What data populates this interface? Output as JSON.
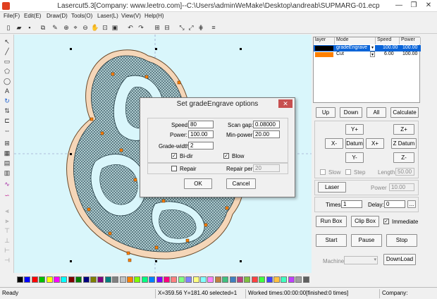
{
  "app": {
    "title": "Lasercut5.3[Company: www.leetro.com]--C:\\Users\\adminWeMake\\Desktop\\andreab\\SUPMARG-01.ecp",
    "min": "—",
    "max": "❐",
    "close": "✕"
  },
  "menu": [
    "File(F)",
    "Edit(E)",
    "Draw(D)",
    "Tools(O)",
    "Laser(L)",
    "View(V)",
    "Help(H)"
  ],
  "layers": {
    "headers": [
      "layer",
      "Mode",
      "Speed",
      "Power"
    ],
    "rows": [
      {
        "color": "#000000",
        "mode": "gradeEngrave",
        "speed": "100.00",
        "power": "100.00",
        "selected": true
      },
      {
        "color": "#ff8000",
        "mode": "Cut",
        "speed": "6.00",
        "power": "100.00",
        "selected": false
      }
    ]
  },
  "panel": {
    "up": "Up",
    "down": "Down",
    "all": "All",
    "calculate": "Calculate",
    "yplus": "Y+",
    "xminus": "X-",
    "datum": "Datum",
    "xplus": "X+",
    "yminus": "Y-",
    "zplus": "Z+",
    "zdatum": "Z Datum",
    "zminus": "Z-",
    "slow": "Slow",
    "step": "Step",
    "length_label": "Length",
    "length_value": "50.00",
    "laser": "Laser",
    "power_label": "Power",
    "power_value": "10.00",
    "times_label": "Times:",
    "times_value": "1",
    "delay_label": "Delay:",
    "delay_value": "0",
    "delay_btn": "...",
    "runbox": "Run Box",
    "clipbox": "Clip Box",
    "immediate": "Immediate",
    "start": "Start",
    "pause": "Pause",
    "stop": "Stop",
    "machine_label": "Machine:",
    "download": "DownLoad"
  },
  "dialog": {
    "title": "Set gradeEngrave options",
    "speed_label": "Speed:",
    "speed": "80",
    "scangap_label": "Scan gap:",
    "scangap": "0.08000",
    "power_label": "Power:",
    "power": "100.00",
    "minpower_label": "Min-power:",
    "minpower": "20.00",
    "gradewidth_label": "Grade-width:",
    "gradewidth": "2",
    "bidir": "Bi-dir",
    "blow": "Blow",
    "repair": "Repair",
    "repairper_label": "Repair per:",
    "repairper": "20",
    "ok": "OK",
    "cancel": "Cancel"
  },
  "palette": [
    "#000000",
    "#0000ff",
    "#ff0000",
    "#00c000",
    "#ffff00",
    "#ff00ff",
    "#00ffff",
    "#800000",
    "#008000",
    "#000080",
    "#808000",
    "#800080",
    "#008080",
    "#808080",
    "#c0c0c0",
    "#ff8000",
    "#80ff00",
    "#00ff80",
    "#0080ff",
    "#8000ff",
    "#ff0080",
    "#ff8080",
    "#80ff80",
    "#8080ff",
    "#ffff80",
    "#80ffff",
    "#ff80ff",
    "#c08040",
    "#40c080",
    "#4080c0",
    "#c04080",
    "#80c040",
    "#ff4040",
    "#40ff40",
    "#4040ff",
    "#ffc040",
    "#40ffc0",
    "#c040ff",
    "#a0a0a0",
    "#606060"
  ],
  "status": {
    "ready": "Ready",
    "coords": "X=359.56 Y=181.40 selected=1",
    "worked": "Worked times:00:00:00[finished:0 times]",
    "company": "Company:"
  }
}
